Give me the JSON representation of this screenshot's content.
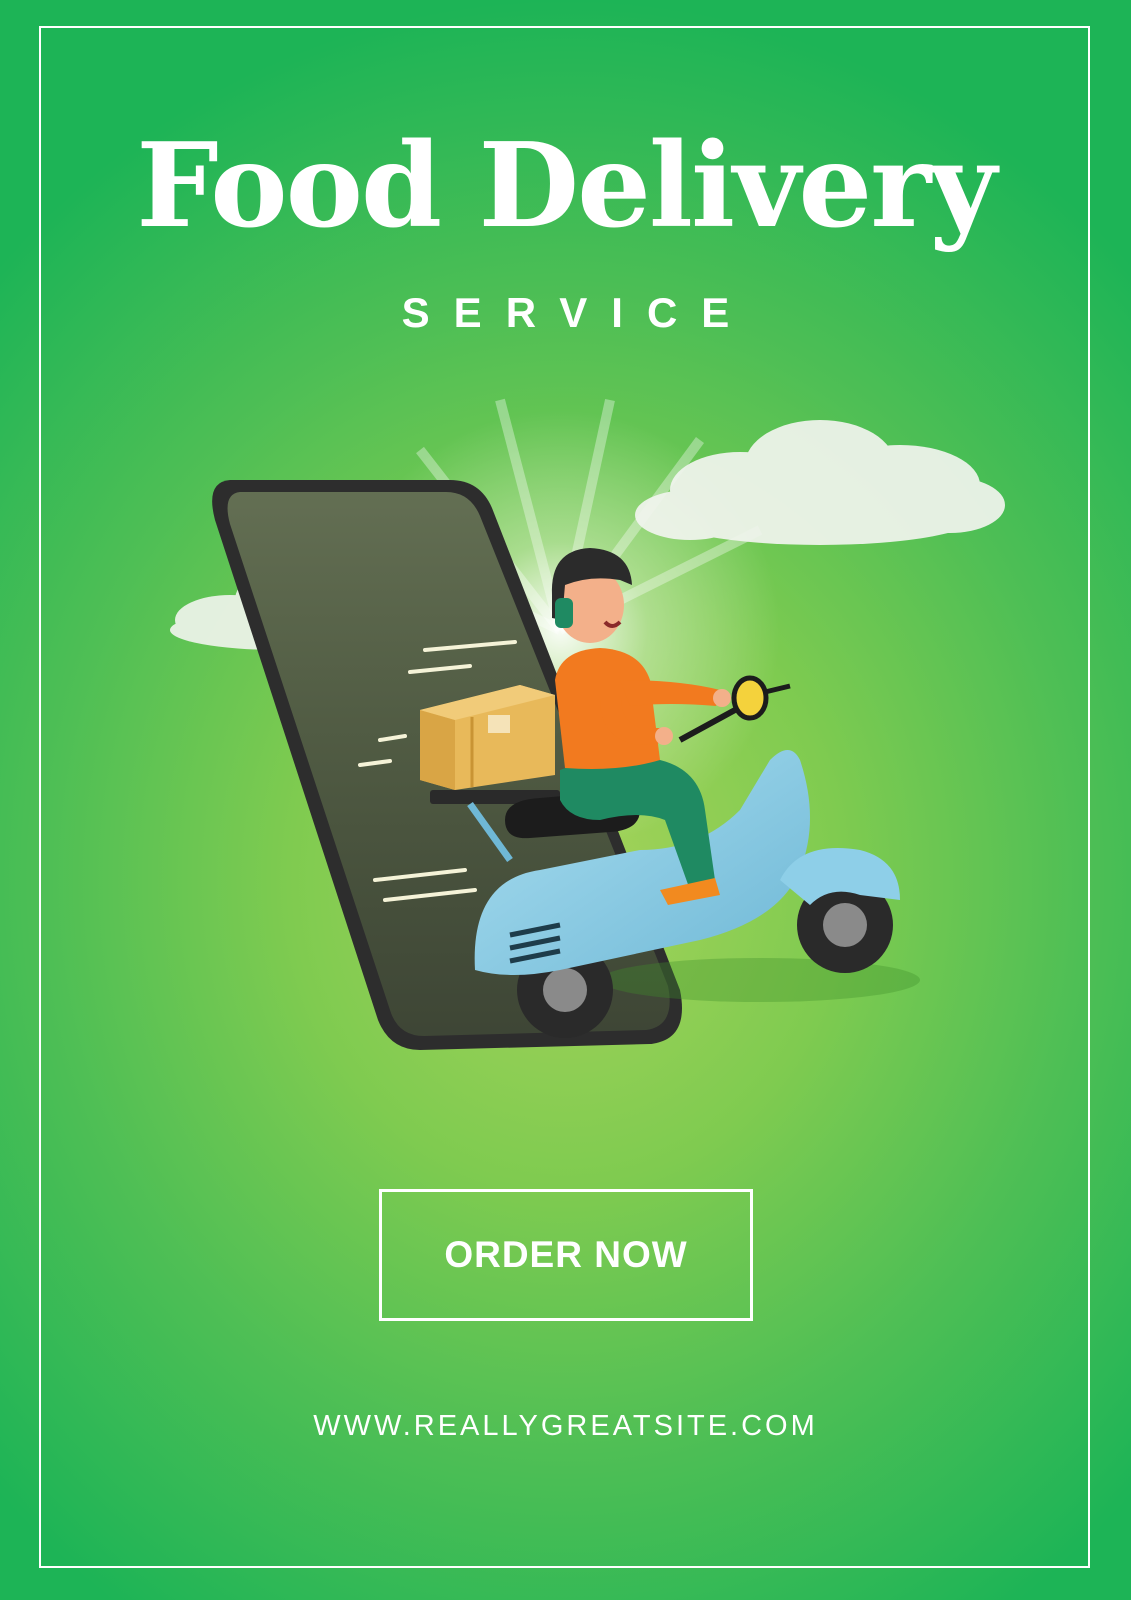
{
  "poster": {
    "title": "Food Delivery",
    "subtitle": "SERVICE",
    "cta_label": "ORDER NOW",
    "website": "WWW.REALLYGREATSITE.COM"
  },
  "illustration": {
    "subject": "delivery-rider-on-scooter-emerging-from-smartphone",
    "icons": [
      "smartphone-icon",
      "scooter-icon",
      "delivery-box-icon",
      "cloud-icon"
    ]
  },
  "colors": {
    "background_edge": "#1db456",
    "background_center": "#a6d35a",
    "text": "#ffffff",
    "scooter": "#8ecfe8",
    "shirt": "#f27a1f",
    "pants": "#1f8a62",
    "box": "#e8b95a"
  }
}
